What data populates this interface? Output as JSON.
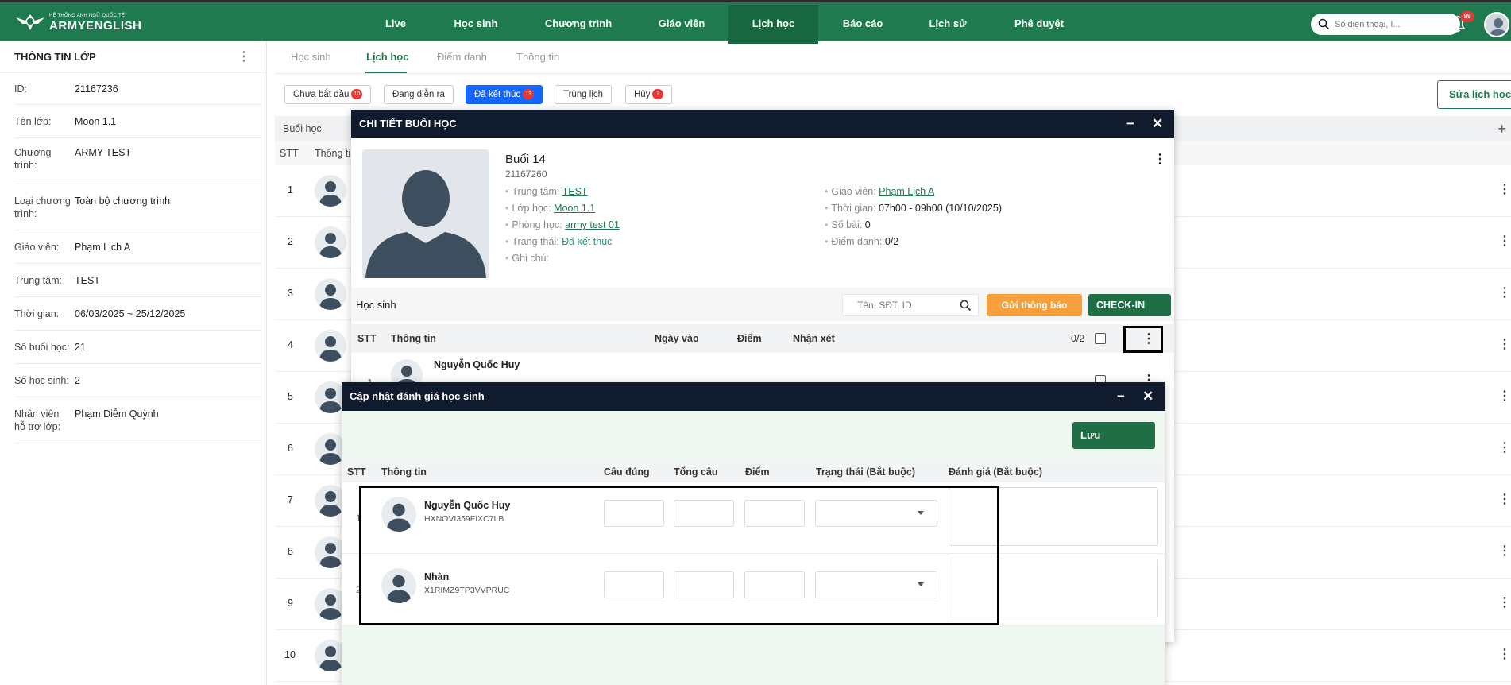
{
  "brand": {
    "small": "HỆ THỐNG ANH NGỮ QUỐC TẾ",
    "name": "ARMYENGLISH"
  },
  "nav": [
    "Live",
    "Học sinh",
    "Chương trình",
    "Giáo viên",
    "Lịch học",
    "Báo cáo",
    "Lịch sử",
    "Phê duyệt"
  ],
  "nav_active": "Lịch học",
  "search": {
    "placeholder": "Số điện thoại, I..."
  },
  "notifications": "99",
  "left": {
    "title": "THÔNG TIN LỚP",
    "rows": [
      {
        "k": "ID:",
        "v": "21167236"
      },
      {
        "k": "Tên lớp:",
        "v": "Moon 1.1"
      },
      {
        "k": "Chương trình:",
        "v": "ARMY TEST"
      },
      {
        "k": "Loại chương trình:",
        "v": "Toàn bộ chương trình"
      },
      {
        "k": "Giáo viên:",
        "v": "Phạm Lịch A"
      },
      {
        "k": "Trung tâm:",
        "v": "TEST"
      },
      {
        "k": "Thời gian:",
        "v": "06/03/2025 ~ 25/12/2025"
      },
      {
        "k": "Số buổi học:",
        "v": "21"
      },
      {
        "k": "Số học sinh:",
        "v": "2"
      },
      {
        "k": "Nhân viên hỗ trợ lớp:",
        "v": "Phạm Diễm Quỳnh"
      }
    ]
  },
  "tabs": [
    "Học sinh",
    "Lịch học",
    "Điểm danh",
    "Thông tin"
  ],
  "tab_active": "Lịch học",
  "filters": [
    {
      "label": "Chưa bắt đầu",
      "count": "10"
    },
    {
      "label": "Đang diễn ra",
      "count": ""
    },
    {
      "label": "Đã kết thúc",
      "count": "13"
    },
    {
      "label": "Trùng lịch",
      "count": ""
    },
    {
      "label": "Hủy",
      "count": "3"
    }
  ],
  "filter_active": "Đã kết thúc",
  "edit_schedule": "Sửa lịch học",
  "sessions": {
    "title": "Buổi học",
    "col_stt": "STT",
    "col_info": "Thông tin",
    "rows": [
      "1",
      "2",
      "3",
      "4",
      "5",
      "6",
      "7",
      "8",
      "9",
      "10"
    ]
  },
  "detail": {
    "title": "CHI TIẾT BUỔI HỌC",
    "session": "Buổi 14",
    "id": "21167260",
    "fields_left": [
      {
        "k": "Trung tâm:",
        "v": "TEST",
        "style": "link"
      },
      {
        "k": "Lớp học:",
        "v": "Moon 1.1",
        "style": "link"
      },
      {
        "k": "Phòng học:",
        "v": "army test 01",
        "style": "link"
      },
      {
        "k": "Trạng thái:",
        "v": "Đã kết thúc",
        "style": "ok"
      },
      {
        "k": "Ghi chú:",
        "v": "",
        "style": "plain"
      }
    ],
    "fields_right": [
      {
        "k": "Giáo viên:",
        "v": "Phạm Lịch A",
        "style": "link"
      },
      {
        "k": "Thời gian:",
        "v": "07h00 - 09h00 (10/10/2025)",
        "style": "plain"
      },
      {
        "k": "Số bài:",
        "v": "0",
        "style": "plain"
      },
      {
        "k": "Điểm danh:",
        "v": "0/2",
        "style": "plain"
      }
    ],
    "students_label": "Học sinh",
    "student_search_placeholder": "Tên, SĐT, ID",
    "notify_btn": "Gửi thông báo",
    "checkin_btn": "CHECK-IN",
    "cols": {
      "stt": "STT",
      "info": "Thông tin",
      "date": "Ngày vào",
      "score": "Điểm",
      "comment": "Nhận xét"
    },
    "attendance": "0/2",
    "first_student": "Nguyễn Quốc Huy",
    "first_num": "1"
  },
  "update": {
    "title": "Cập nhật đánh giá học sinh",
    "save": "Lưu",
    "cols": {
      "stt": "STT",
      "info": "Thông tin",
      "correct": "Câu đúng",
      "total": "Tổng câu",
      "score": "Điểm",
      "status": "Trạng thái (Bắt buộc)",
      "eval": "Đánh giá (Bắt buộc)"
    },
    "students": [
      {
        "num": "1",
        "name": "Nguyễn Quốc Huy",
        "code": "HXNOVI359FIXC7LB"
      },
      {
        "num": "2",
        "name": "Nhàn",
        "code": "X1RIMZ9TP3VVPRUC"
      }
    ]
  },
  "colors": {
    "brand": "#1f7a4f",
    "header_dark": "#111b2e",
    "orange": "#f7a03b",
    "blue": "#1565ff"
  }
}
